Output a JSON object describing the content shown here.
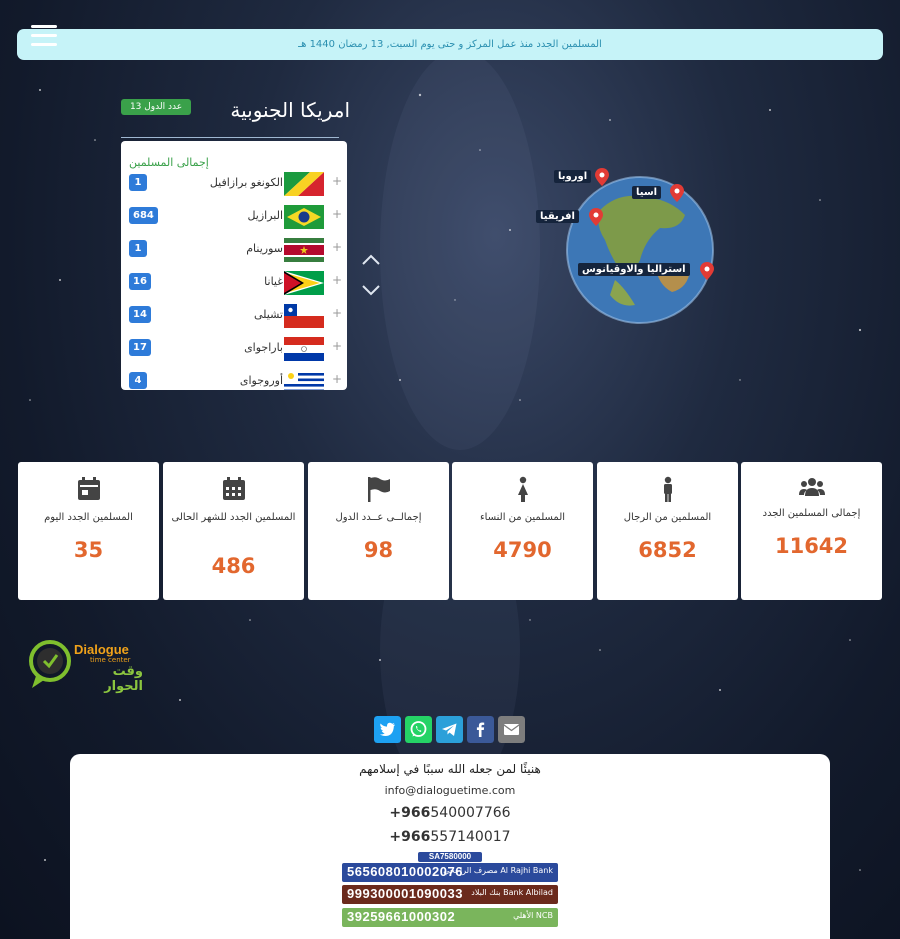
{
  "header": {
    "banner": "المسلمين الجدد منذ عمل المركز و حتى يوم السبت, 13 رمضان 1440 هـ"
  },
  "region": {
    "count_badge": "عدد الدول 13",
    "title": "امريكا الجنوبية",
    "panel_header": "إجمالى المسلمين",
    "countries": [
      {
        "name": "الكونغو برازافيل",
        "count": "1",
        "flag": "congo-flag"
      },
      {
        "name": "البرازيل",
        "count": "684",
        "flag": "brazil-flag"
      },
      {
        "name": "سورينام",
        "count": "1",
        "flag": "suriname-flag"
      },
      {
        "name": "غيانا",
        "count": "16",
        "flag": "guyana-flag"
      },
      {
        "name": "تشيلى",
        "count": "14",
        "flag": "chile-flag"
      },
      {
        "name": "باراجواى",
        "count": "17",
        "flag": "paraguay-flag"
      },
      {
        "name": "أوروجواى",
        "count": "4",
        "flag": "uruguay-flag"
      }
    ],
    "plus": "+"
  },
  "map": {
    "continents": {
      "europe": "اوروبا",
      "asia": "اسيا",
      "africa": "افريقيا",
      "oceania": "استراليا والاوقيانوس"
    }
  },
  "stats": [
    {
      "label": "المسلمين الجدد اليوم",
      "value": "35",
      "icon": "calendar-day-icon"
    },
    {
      "label": "المسلمين الجدد للشهر الحالى",
      "value": "486",
      "icon": "calendar-month-icon"
    },
    {
      "label": "إجمالــى عــدد الدول",
      "value": "98",
      "icon": "flag-icon"
    },
    {
      "label": "المسلمين من النساء",
      "value": "4790",
      "icon": "female-icon"
    },
    {
      "label": "المسلمين من الرجال",
      "value": "6852",
      "icon": "male-icon"
    },
    {
      "label": "إجمالى المسلمين الجدد",
      "value": "11642",
      "icon": "users-icon"
    }
  ],
  "logo": {
    "text_en": "Dialogue",
    "text_sub": "time center",
    "text_ar": "وقت الحوار"
  },
  "footer": {
    "tagline": "هنيئًا لمن جعله الله سببًا في إسلامهم",
    "email": "info@dialoguetime.com",
    "phone1_prefix": "+966",
    "phone1_number": "540007766",
    "phone2_prefix": "+966",
    "phone2_number": "557140017",
    "iban_tag": "SA7580000",
    "banks": [
      {
        "account": "565608010002076",
        "name": "مصرف الراجحي Al Rajhi Bank",
        "color": "#2b4a9c"
      },
      {
        "account": "999300001090033",
        "name": "بنك البلاد Bank Albilad",
        "color": "#6b2a1c"
      },
      {
        "account": "39259661000302",
        "name": "الأهلي NCB",
        "color": "#7ab55c"
      }
    ]
  },
  "colors": {
    "accent_green": "#3aa14a",
    "badge_blue": "#2e7bd9",
    "value_orange": "#e2672e",
    "banner_bg": "#c6f3f8"
  }
}
